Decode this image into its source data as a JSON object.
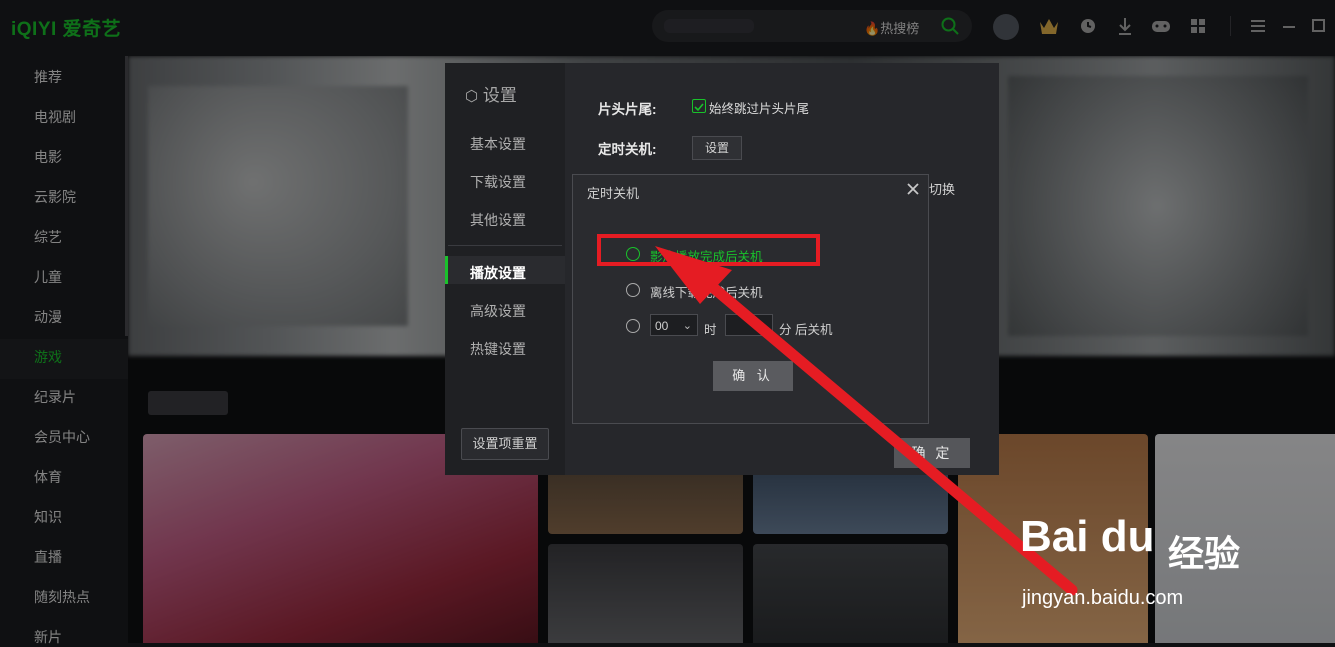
{
  "app": {
    "logo_text": "iQIYI 爱奇艺",
    "search_hot": "热搜榜",
    "brand_color": "#19c22b"
  },
  "sidebar": {
    "items": [
      {
        "label": "推荐"
      },
      {
        "label": "电视剧"
      },
      {
        "label": "电影"
      },
      {
        "label": "云影院"
      },
      {
        "label": "综艺"
      },
      {
        "label": "儿童"
      },
      {
        "label": "动漫"
      },
      {
        "label": "游戏"
      },
      {
        "label": "纪录片"
      },
      {
        "label": "会员中心"
      },
      {
        "label": "体育"
      },
      {
        "label": "知识"
      },
      {
        "label": "直播"
      },
      {
        "label": "随刻热点"
      },
      {
        "label": "新片"
      }
    ],
    "active": "游戏"
  },
  "settings": {
    "title": "设置",
    "nav": [
      "基本设置",
      "下载设置",
      "其他设置",
      "播放设置",
      "高级设置",
      "热键设置"
    ],
    "active_nav": "播放设置",
    "reset_label": "设置项重置",
    "rows": {
      "intro_outro_label": "片头片尾:",
      "skip_checkbox": "始终跳过片头片尾",
      "timer_label": "定时关机:",
      "timer_button": "设置",
      "fragment": "切换"
    },
    "ok_label": "确 定"
  },
  "dialog": {
    "title": "定时关机",
    "options": [
      {
        "label": "影片播放完成后关机",
        "selected": true
      },
      {
        "label": "离线下载完成后关机",
        "selected": false
      }
    ],
    "hour_value": "00",
    "hour_unit": "时",
    "minute_value": "",
    "minute_unit": "分 后关机",
    "confirm_label": "确 认"
  },
  "watermark": {
    "brand": "Bai du",
    "jingyan": "经验",
    "url": "jingyan.baidu.com"
  }
}
